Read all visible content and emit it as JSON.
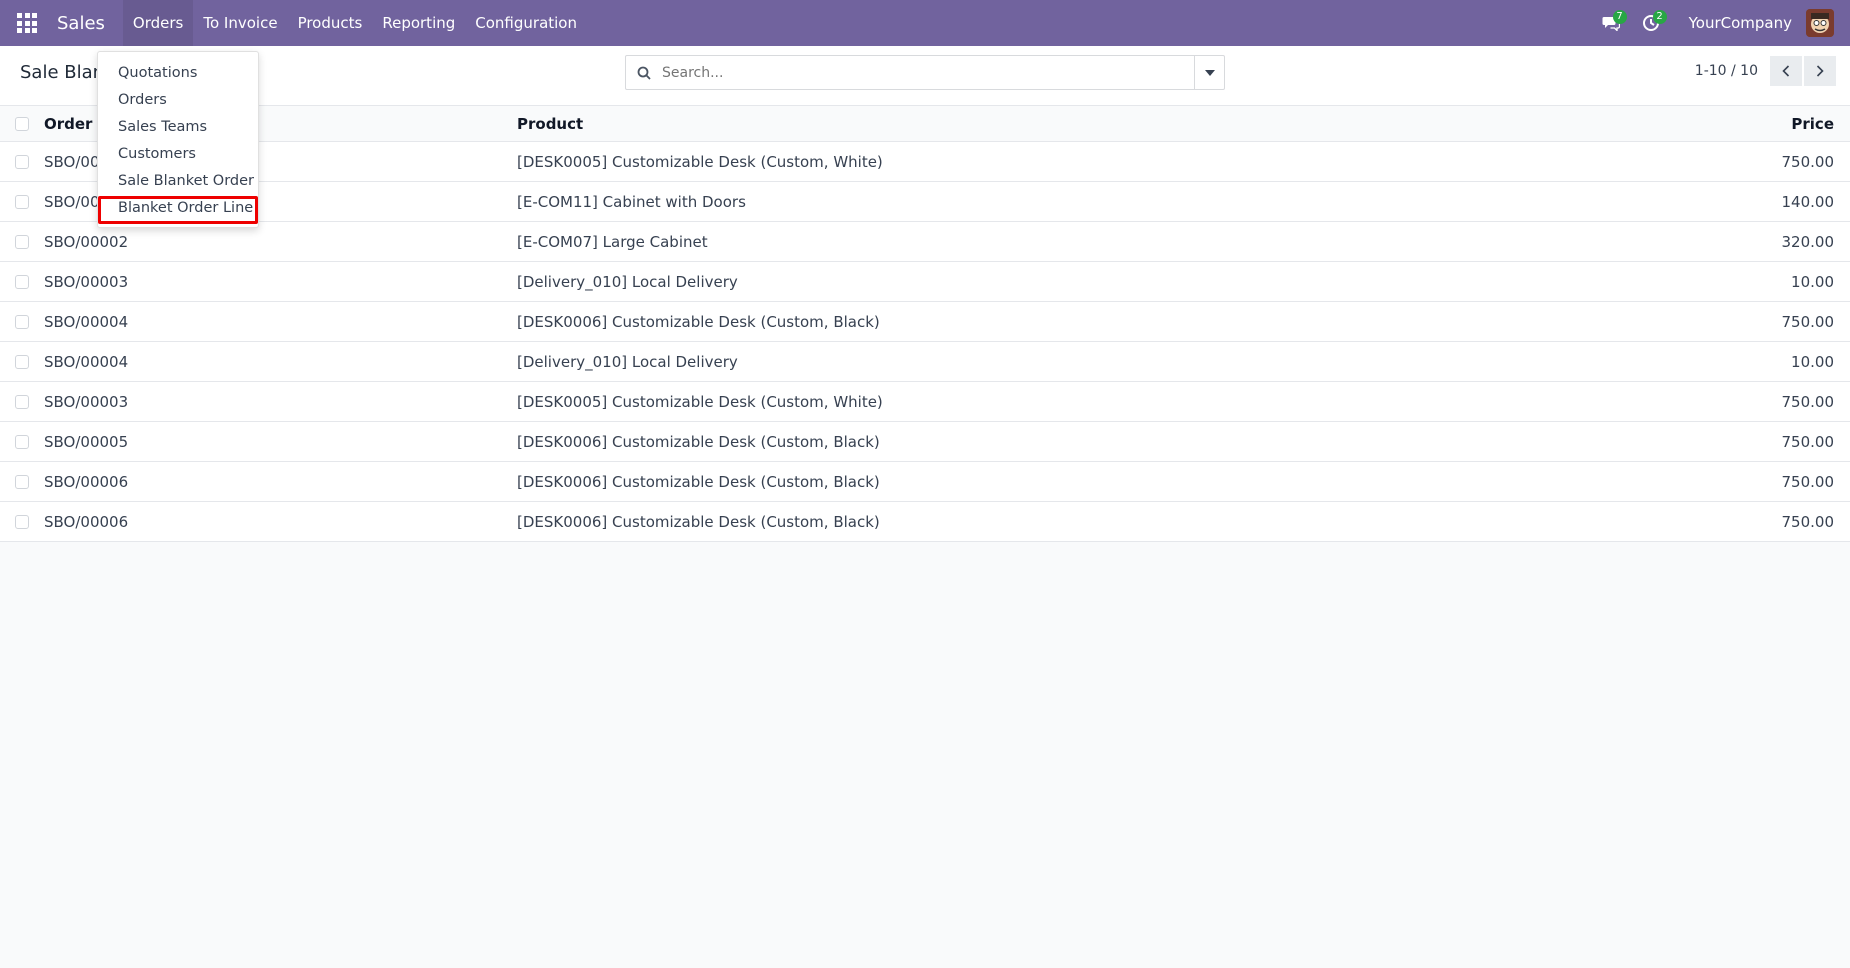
{
  "navbar": {
    "app_name": "Sales",
    "menu": [
      "Orders",
      "To Invoice",
      "Products",
      "Reporting",
      "Configuration"
    ],
    "messages_count": "7",
    "activities_count": "2",
    "company": "YourCompany",
    "color": "#71639e"
  },
  "control_panel": {
    "title": "Sale Blank",
    "search_placeholder": "Search...",
    "pager": "1-10 / 10"
  },
  "dropdown": {
    "items": [
      "Quotations",
      "Orders",
      "Sales Teams",
      "Customers",
      "Sale Blanket Order",
      "Blanket Order Line"
    ],
    "highlighted": "Blanket Order Line"
  },
  "list": {
    "columns": {
      "ref": "Order Re",
      "product": "Product",
      "price": "Price"
    },
    "rows": [
      {
        "ref": "SBO/000",
        "product": "[DESK0005] Customizable Desk (Custom, White)",
        "price": "750.00"
      },
      {
        "ref": "SBO/000",
        "product": "[E-COM11] Cabinet with Doors",
        "price": "140.00"
      },
      {
        "ref": "SBO/00002",
        "product": "[E-COM07] Large Cabinet",
        "price": "320.00"
      },
      {
        "ref": "SBO/00003",
        "product": "[Delivery_010] Local Delivery",
        "price": "10.00"
      },
      {
        "ref": "SBO/00004",
        "product": "[DESK0006] Customizable Desk (Custom, Black)",
        "price": "750.00"
      },
      {
        "ref": "SBO/00004",
        "product": "[Delivery_010] Local Delivery",
        "price": "10.00"
      },
      {
        "ref": "SBO/00003",
        "product": "[DESK0005] Customizable Desk (Custom, White)",
        "price": "750.00"
      },
      {
        "ref": "SBO/00005",
        "product": "[DESK0006] Customizable Desk (Custom, Black)",
        "price": "750.00"
      },
      {
        "ref": "SBO/00006",
        "product": "[DESK0006] Customizable Desk (Custom, Black)",
        "price": "750.00"
      },
      {
        "ref": "SBO/00006",
        "product": "[DESK0006] Customizable Desk (Custom, Black)",
        "price": "750.00"
      }
    ]
  }
}
